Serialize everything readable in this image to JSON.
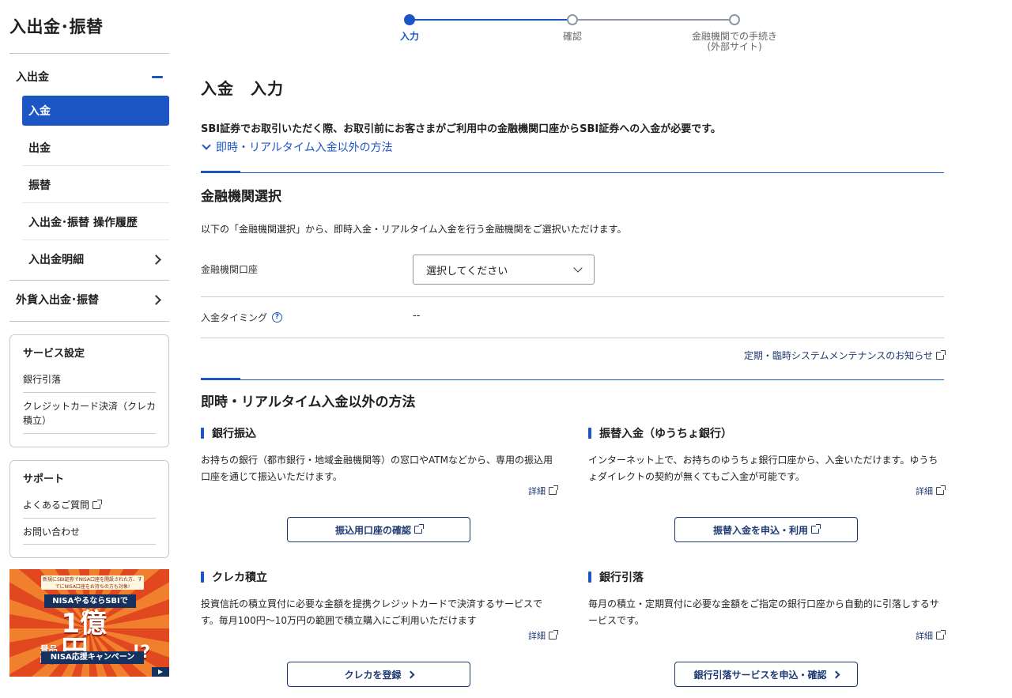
{
  "sidebar": {
    "title": "入出金･振替",
    "group_main": "入出金",
    "items": [
      {
        "label": "入金"
      },
      {
        "label": "出金"
      },
      {
        "label": "振替"
      },
      {
        "label": "入出金･振替 操作履歴"
      },
      {
        "label": "入出金明細"
      }
    ],
    "group_fx": "外貨入出金･振替",
    "service_panel": {
      "title": "サービス設定",
      "links": [
        "銀行引落",
        "クレジットカード決済（クレカ積立）"
      ]
    },
    "support_panel": {
      "title": "サポート",
      "links": [
        "よくあるご質問",
        "お問い合わせ"
      ]
    },
    "banner": {
      "top_text": "新規にSBI証券でNISA口座を開設された方、すでにNISA口座をお持ちの方も対象!",
      "line1": "NISAやるならSBIでGO!",
      "prize_label": "景品総額",
      "amount": "1億円",
      "amount_suffix": "!?",
      "line2": "NISA応援キャンペーン"
    }
  },
  "stepper": {
    "steps": [
      {
        "label": "入力"
      },
      {
        "label": "確認"
      },
      {
        "label": "金融機関での手続き",
        "sub": "(外部サイト)"
      }
    ],
    "current": 0
  },
  "main": {
    "title": "入金　入力",
    "intro": "SBI証券でお取引いただく際、お取引前にお客さまがご利用中の金融機関口座からSBI証券への入金が必要です。",
    "toggle_link": "即時・リアルタイム入金以外の方法",
    "select_section": {
      "title": "金融機関選択",
      "description": "以下の「金融機関選択」から、即時入金・リアルタイム入金を行う金融機関をご選択いただけます。",
      "account_label": "金融機関口座",
      "account_placeholder": "選択してください",
      "timing_label": "入金タイミング",
      "timing_value": "--",
      "maintenance_link": "定期・臨時システムメンテナンスのお知らせ"
    },
    "other_section": {
      "title": "即時・リアルタイム入金以外の方法",
      "detail_label": "詳細",
      "cards": [
        {
          "title": "銀行振込",
          "text": "お持ちの銀行（都市銀行・地域金融機関等）の窓口やATMなどから、専用の振込用口座を通じて振込いただけます。",
          "button": "振込用口座の確認"
        },
        {
          "title": "振替入金（ゆうちょ銀行）",
          "text": "インターネット上で、お持ちのゆうちょ銀行口座から、入金いただけます。ゆうちょダイレクトの契約が無くてもご入金が可能です。",
          "button": "振替入金を申込・利用"
        },
        {
          "title": "クレカ積立",
          "text": "投資信託の積立買付に必要な金額を提携クレジットカードで決済するサービスです。毎月100円～10万円の範囲で積立購入にご利用いただけます",
          "button": "クレカを登録"
        },
        {
          "title": "銀行引落",
          "text": "毎月の積立・定期買付に必要な金額をご指定の銀行口座から自動的に引落しするサービスです。",
          "button": "銀行引落サービスを申込・確認"
        }
      ]
    }
  },
  "colors": {
    "accent": "#1c56c5",
    "navy": "#1f3a73",
    "border": "#c7ccd3"
  }
}
